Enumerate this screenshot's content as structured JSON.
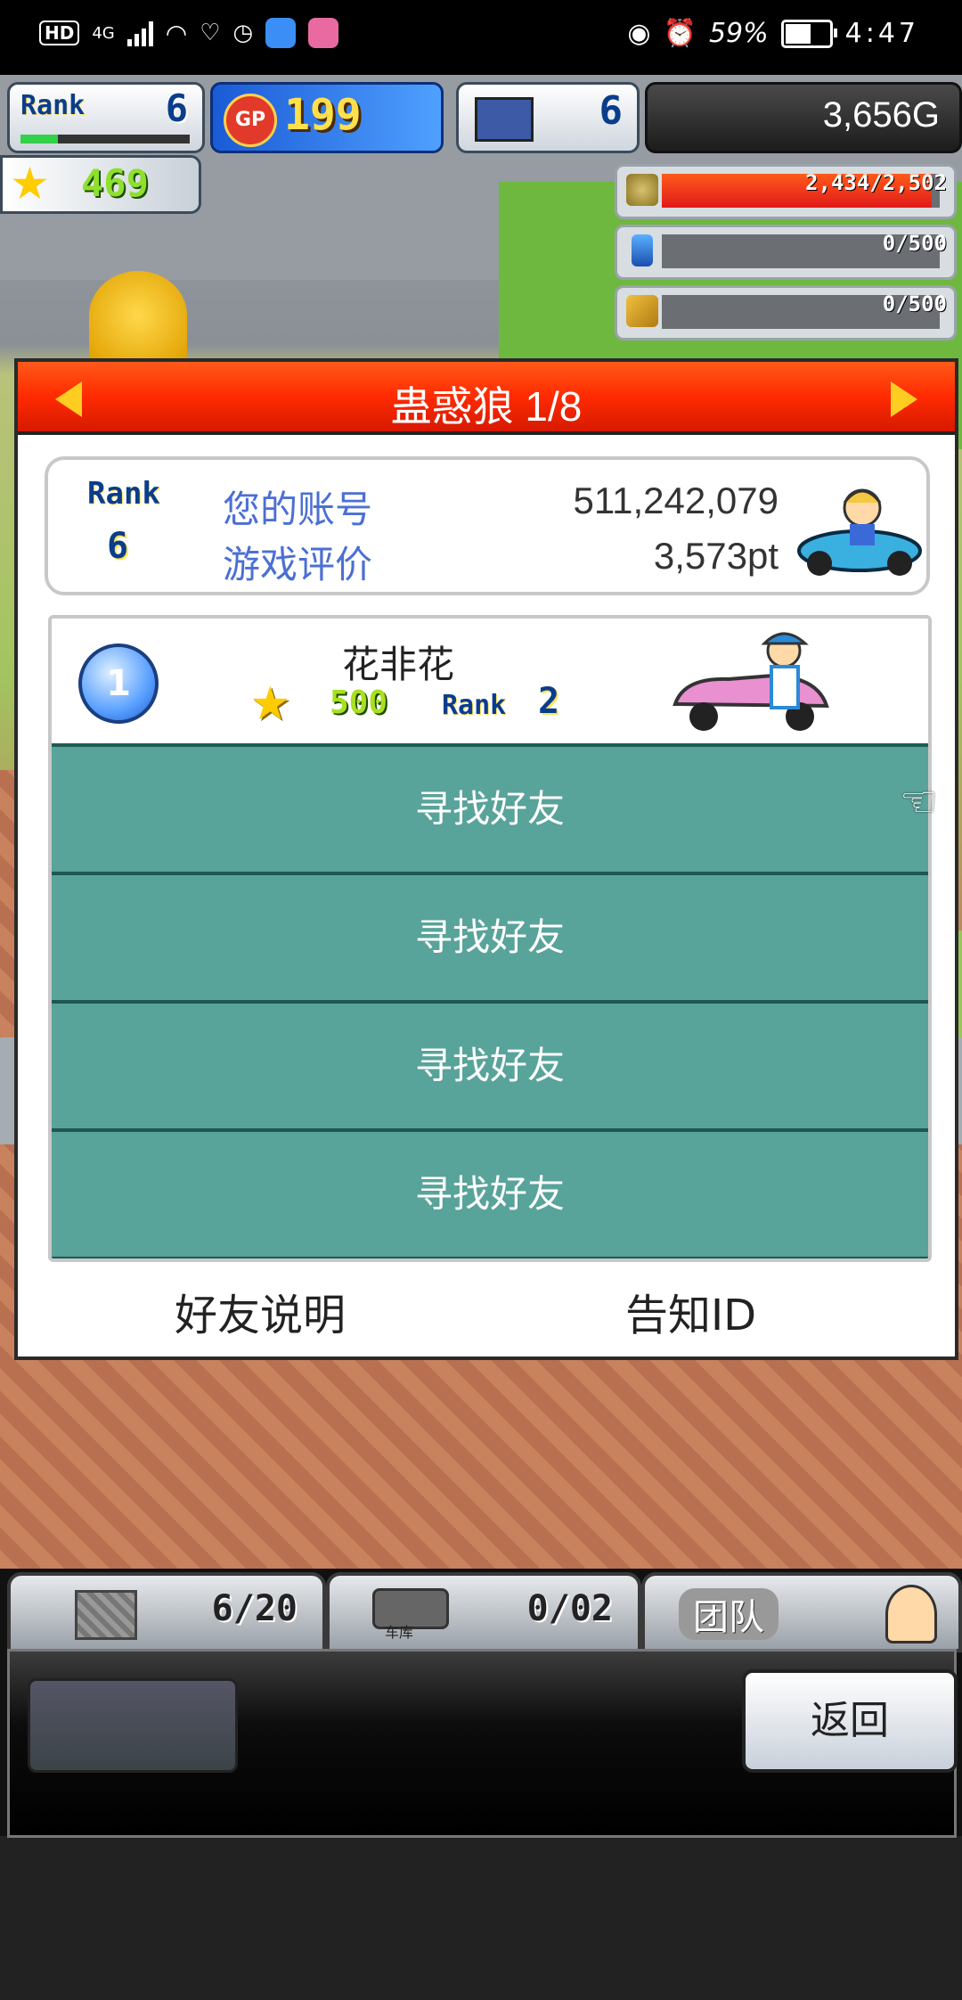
{
  "status_bar": {
    "hd": "HD",
    "network": "4G",
    "battery": "59%",
    "time": "4:47"
  },
  "hud": {
    "rank_label": "Rank",
    "rank_value": "6",
    "gp_icon": "GP",
    "gp_value": "199",
    "pc_value": "6",
    "money": "3,656G",
    "star_value": "469",
    "resources": [
      {
        "icon": "coin-stack-icon",
        "label": "2,434/2,502",
        "fill": 0.97
      },
      {
        "icon": "fuel-bottle-icon",
        "label": "0/500",
        "fill": 0
      },
      {
        "icon": "wheat-icon",
        "label": "0/500",
        "fill": 0
      }
    ]
  },
  "dialog": {
    "title": "蛊惑狼 1/8",
    "account": {
      "rank_label": "Rank",
      "rank_value": "6",
      "account_label": "您的账号",
      "account_value": "511,242,079",
      "rating_label": "游戏评价",
      "rating_value": "3,573pt"
    },
    "friends": [
      {
        "badge": "1",
        "name": "花非花",
        "stars": "500",
        "rank_label": "Rank",
        "rank": "2"
      }
    ],
    "find_buttons": [
      "寻找好友",
      "寻找好友",
      "寻找好友",
      "寻找好友"
    ],
    "footer_left": "好友说明",
    "footer_right": "告知ID"
  },
  "bottom": {
    "tab1_value": "6/20",
    "tab2_value": "0/02",
    "tab2_caption": "车库",
    "tab3_label": "团队",
    "back_label": "返回"
  },
  "colors": {
    "header_red": "#ff2a00",
    "find_teal": "#58a39a",
    "link_blue": "#4b6fd3"
  }
}
